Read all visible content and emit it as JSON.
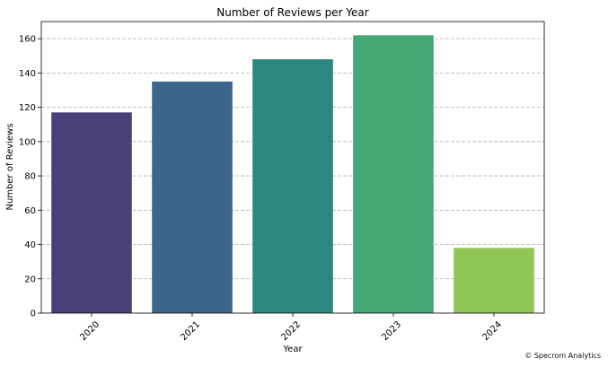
{
  "chart_data": {
    "type": "bar",
    "title": "Number of Reviews per Year",
    "xlabel": "Year",
    "ylabel": "Number of Reviews",
    "categories": [
      "2020",
      "2021",
      "2022",
      "2023",
      "2024"
    ],
    "values": [
      117,
      135,
      148,
      162,
      38
    ],
    "colors": [
      "#4b3f7a",
      "#3d648a",
      "#2c8781",
      "#44a874",
      "#90c655"
    ],
    "ylim": [
      0,
      170
    ],
    "yticks": [
      0,
      20,
      40,
      60,
      80,
      100,
      120,
      140,
      160
    ],
    "grid": "horizontal dashed"
  },
  "footer": {
    "credit": "© Specrom Analytics"
  }
}
